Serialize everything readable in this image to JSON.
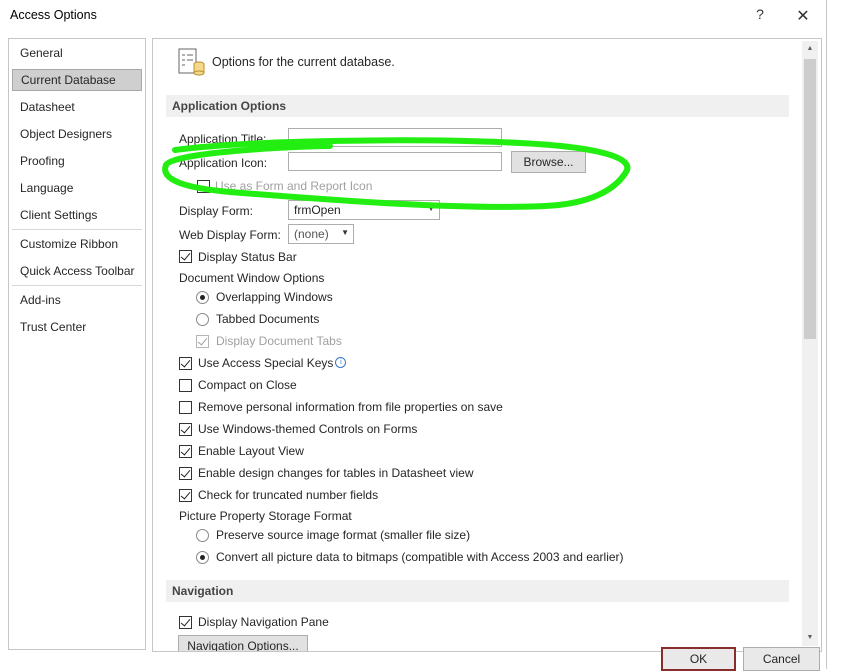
{
  "window": {
    "title": "Access Options",
    "help": "?",
    "close": "✕"
  },
  "sidebar": {
    "items": [
      {
        "label": "General"
      },
      {
        "label": "Current Database",
        "active": true
      },
      {
        "label": "Datasheet"
      },
      {
        "label": "Object Designers"
      },
      {
        "label": "Proofing"
      },
      {
        "label": "Language"
      },
      {
        "label": "Client Settings"
      },
      {
        "label": "Customize Ribbon"
      },
      {
        "label": "Quick Access Toolbar"
      },
      {
        "label": "Add-ins"
      },
      {
        "label": "Trust Center"
      }
    ]
  },
  "header": {
    "text": "Options for the current database.",
    "icon": "database-options-icon"
  },
  "app_options": {
    "section_label": "Application Options",
    "title_label": "Application Title:",
    "title_value": "",
    "icon_label": "Application Icon:",
    "icon_value": "",
    "browse_label": "Browse...",
    "hidden_option_label": "Use as Form and Report Icon",
    "display_form_label": "Display Form:",
    "display_form_value": "frmOpen",
    "web_display_form_label": "Web Display Form:",
    "web_display_form_value": "(none)",
    "status_bar_label": "Display Status Bar",
    "status_bar_checked": true,
    "doc_window_label": "Document Window Options",
    "overlapping_label": "Overlapping Windows",
    "overlapping_selected": true,
    "tabbed_label": "Tabbed Documents",
    "tabbed_selected": false,
    "doc_tabs_label": "Display Document Tabs",
    "doc_tabs_checked": true,
    "special_keys_label": "Use Access Special Keys",
    "special_keys_checked": true,
    "compact_label": "Compact on Close",
    "compact_checked": false,
    "remove_info_label": "Remove personal information from file properties on save",
    "remove_info_checked": false,
    "themed_controls_label": "Use Windows-themed Controls on Forms",
    "themed_controls_checked": true,
    "layout_view_label": "Enable Layout View",
    "layout_view_checked": true,
    "design_changes_label": "Enable design changes for tables in Datasheet view",
    "design_changes_checked": true,
    "truncated_label": "Check for truncated number fields",
    "truncated_checked": true,
    "picture_storage_label": "Picture Property Storage Format",
    "preserve_label": "Preserve source image format (smaller file size)",
    "preserve_selected": false,
    "convert_label": "Convert all picture data to bitmaps (compatible with Access 2003 and earlier)",
    "convert_selected": true
  },
  "navigation": {
    "section_label": "Navigation",
    "display_pane_label": "Display Navigation Pane",
    "display_pane_checked": true,
    "nav_options_label": "Navigation Options..."
  },
  "footer": {
    "ok_label": "OK",
    "cancel_label": "Cancel"
  },
  "annotation": {
    "color": "#22ee11"
  },
  "colors": {
    "accent": "#cfcfcf",
    "section_bg": "#f0f0f0",
    "ok_border": "#8b2c2c"
  }
}
